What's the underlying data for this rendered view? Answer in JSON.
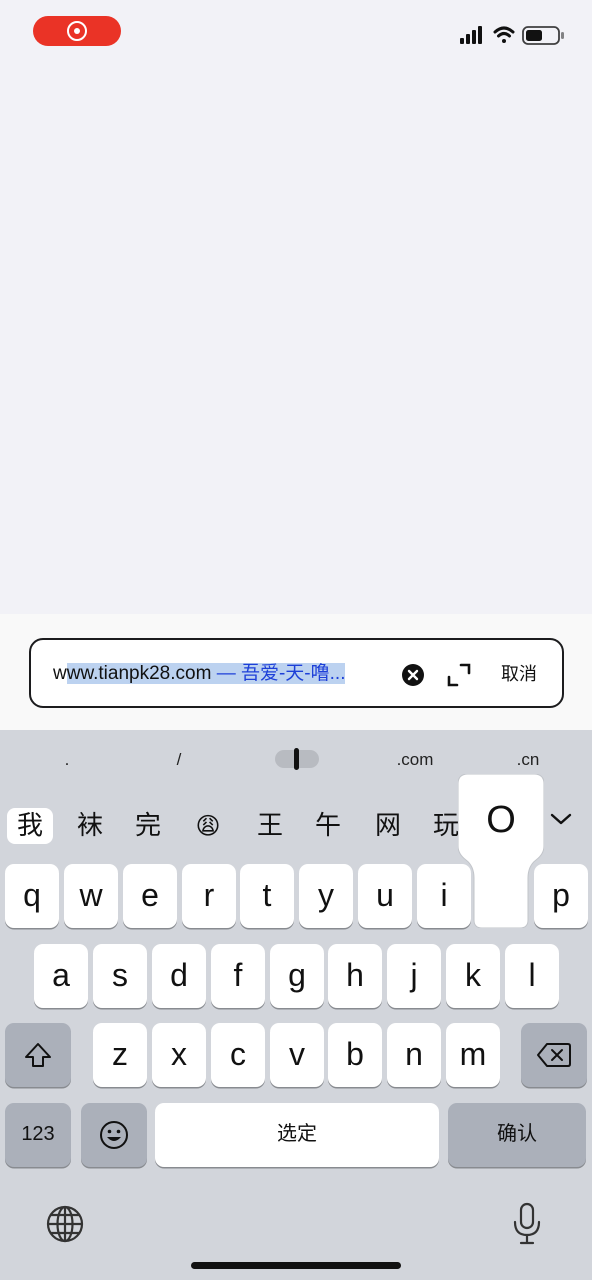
{
  "address_bar": {
    "url_highlighted_prefix": "w",
    "url_selected": "ww.tianpk28.com",
    "page_title": " — 吾爱-天-噜...",
    "cancel_label": "取消"
  },
  "shortcuts": [
    ".",
    "/",
    ".com",
    ".cn"
  ],
  "candidates": [
    "我",
    "袜",
    "完",
    "😩",
    "王",
    "午",
    "网",
    "玩"
  ],
  "keyboard": {
    "row1": [
      "q",
      "w",
      "e",
      "r",
      "t",
      "y",
      "u",
      "i",
      "p"
    ],
    "row2": [
      "a",
      "s",
      "d",
      "f",
      "g",
      "h",
      "j",
      "k",
      "l"
    ],
    "row3": [
      "z",
      "x",
      "c",
      "v",
      "b",
      "n",
      "m"
    ],
    "popup_key": "O",
    "numbers_label": "123",
    "space_label": "选定",
    "return_label": "确认"
  },
  "icons": {
    "status": [
      "recording-indicator",
      "cellular-signal-icon",
      "wifi-icon",
      "battery-icon"
    ],
    "field": [
      "clear-icon",
      "expand-icon"
    ],
    "keyboard": [
      "shift-icon",
      "delete-icon",
      "emoji-icon",
      "globe-icon",
      "microphone-icon",
      "chevron-down-icon"
    ]
  },
  "colors": {
    "record": "#ea3326",
    "selection": "#bcd2f0",
    "title_text": "#1d3fd8",
    "keyboard_bg": "#d2d5db"
  }
}
